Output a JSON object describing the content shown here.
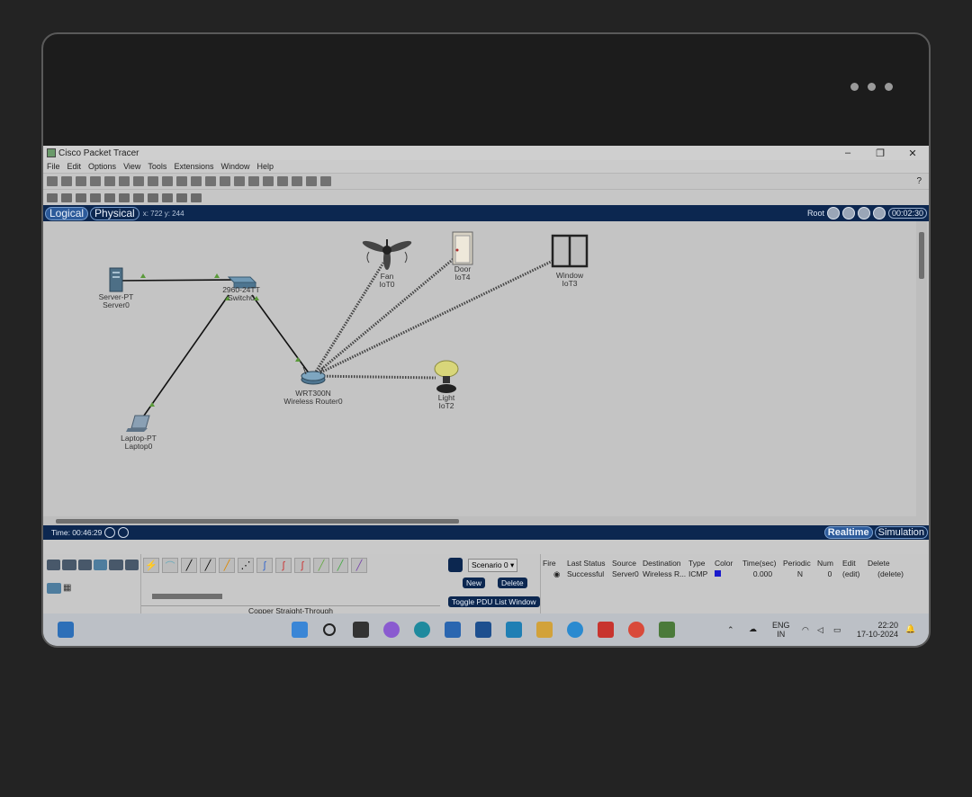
{
  "window": {
    "title": "Cisco Packet Tracer",
    "controls": [
      "–",
      "❐",
      "✕"
    ]
  },
  "menu": [
    "File",
    "Edit",
    "Options",
    "View",
    "Tools",
    "Extensions",
    "Window",
    "Help"
  ],
  "toolbar": {
    "help": "?"
  },
  "modes": {
    "logical": "Logical",
    "physical": "Physical",
    "coords": "x: 722  y: 244",
    "root": "Root",
    "clock": "00:02:30"
  },
  "devices": {
    "server": {
      "type": "Server-PT",
      "name": "Server0"
    },
    "switch": {
      "type": "2960-24TT",
      "name": "Switch0"
    },
    "router": {
      "type": "WRT300N",
      "name": "Wireless Router0"
    },
    "laptop": {
      "type": "Laptop-PT",
      "name": "Laptop0"
    },
    "fan": {
      "type": "Fan",
      "name": "IoT0"
    },
    "door": {
      "type": "Door",
      "name": "IoT4"
    },
    "window": {
      "type": "Window",
      "name": "IoT3"
    },
    "light": {
      "type": "Light",
      "name": "IoT2"
    }
  },
  "status": {
    "time": "Time: 00:46:29",
    "realtime": "Realtime",
    "simulation": "Simulation"
  },
  "cable": {
    "selected": "Copper Straight-Through"
  },
  "scenario": {
    "name": "Scenario 0",
    "new": "New",
    "delete": "Delete",
    "toggle": "Toggle PDU List Window"
  },
  "pdu": {
    "headers": [
      "Fire",
      "Last Status",
      "Source",
      "Destination",
      "Type",
      "Color",
      "Time(sec)",
      "Periodic",
      "Num",
      "Edit",
      "Delete"
    ],
    "row": [
      "",
      "Successful",
      "Server0",
      "Wireless R...",
      "ICMP",
      "",
      "0.000",
      "N",
      "0",
      "(edit)",
      "(delete)"
    ],
    "color": "#1a1acc"
  },
  "tray": {
    "lang": "ENG",
    "region": "IN",
    "time": "22:20",
    "date": "17-10-2024"
  }
}
